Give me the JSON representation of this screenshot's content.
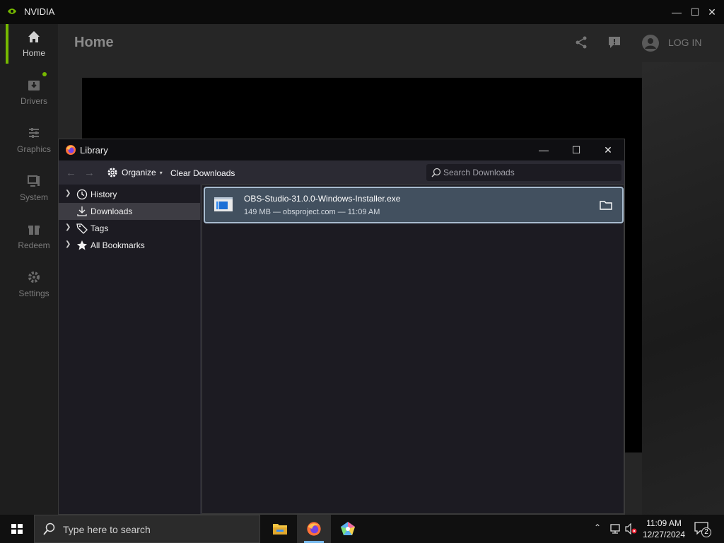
{
  "nvidia": {
    "window_title": "NVIDIA",
    "header_title": "Home",
    "login_label": "LOG IN",
    "brand_color": "#76b900",
    "sidebar": [
      {
        "label": "Home",
        "icon": "home-icon",
        "active": true
      },
      {
        "label": "Drivers",
        "icon": "download-icon",
        "badge": true
      },
      {
        "label": "Graphics",
        "icon": "sliders-icon"
      },
      {
        "label": "System",
        "icon": "monitor-icon"
      },
      {
        "label": "Redeem",
        "icon": "gift-icon"
      },
      {
        "label": "Settings",
        "icon": "gear-icon"
      }
    ]
  },
  "library": {
    "window_title": "Library",
    "toolbar": {
      "organize_label": "Organize",
      "clear_label": "Clear Downloads",
      "search_placeholder": "Search Downloads"
    },
    "tree": [
      {
        "label": "History",
        "icon": "clock-icon",
        "expandable": true
      },
      {
        "label": "Downloads",
        "icon": "download-icon",
        "selected": true
      },
      {
        "label": "Tags",
        "icon": "tag-icon",
        "expandable": true
      },
      {
        "label": "All Bookmarks",
        "icon": "star-icon",
        "expandable": true
      }
    ],
    "downloads": [
      {
        "name": "OBS-Studio-31.0.0-Windows-Installer.exe",
        "meta": "149 MB — obsproject.com — 11:09 AM"
      }
    ]
  },
  "taskbar": {
    "search_placeholder": "Type here to search",
    "time": "11:09 AM",
    "date": "12/27/2024",
    "notification_count": "2"
  }
}
